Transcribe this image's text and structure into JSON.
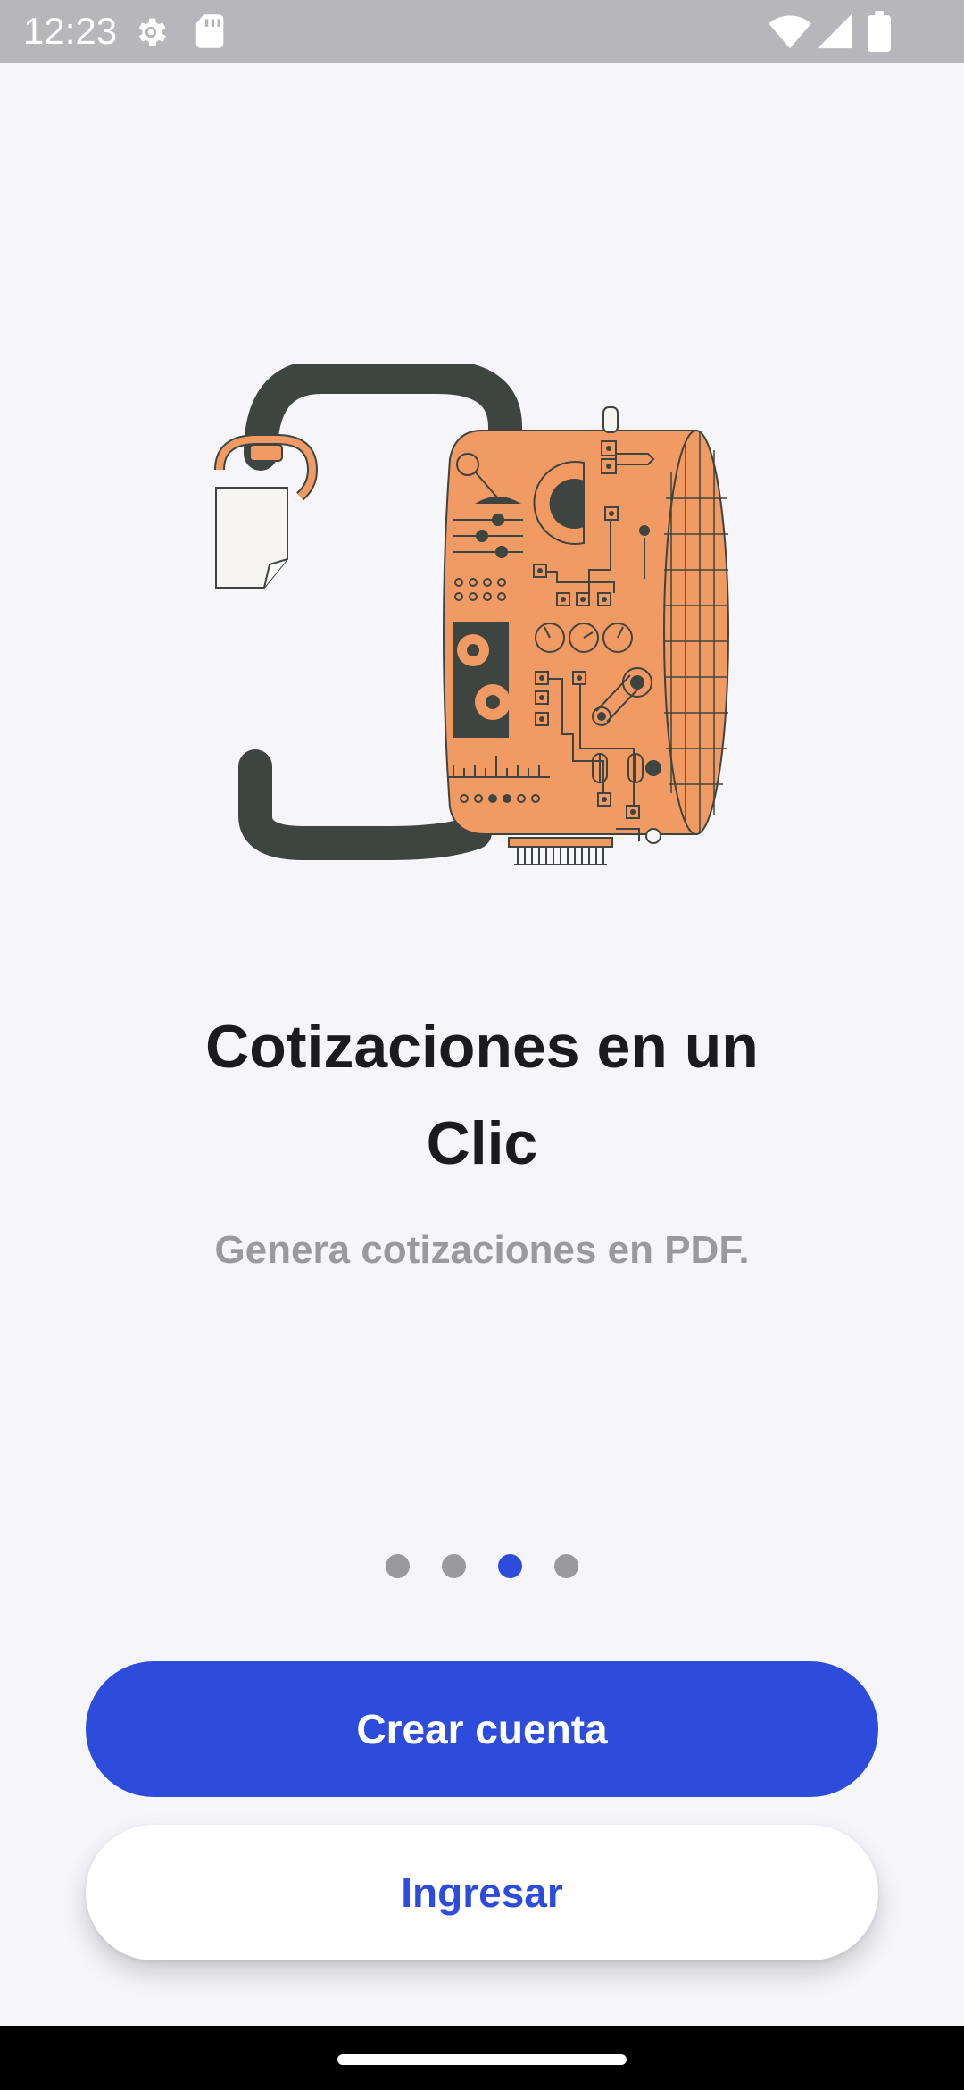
{
  "status_bar": {
    "time": "12:23",
    "icons": [
      "gear-icon",
      "sd-card-icon",
      "wifi-icon",
      "cell-signal-icon",
      "battery-icon"
    ]
  },
  "onboarding": {
    "illustration": "machine-illustration",
    "title": "Cotizaciones en un Clic",
    "subtitle": "Genera cotizaciones en PDF.",
    "page_count": 4,
    "active_page": 3
  },
  "buttons": {
    "create_account": "Crear cuenta",
    "login": "Ingresar"
  },
  "colors": {
    "accent": "#2d4cdb",
    "background": "#f6f5fa",
    "title": "#1b1a1f",
    "subtitle": "#9a999e",
    "illustration_orange": "#f19a64",
    "illustration_dark": "#3e4440"
  }
}
